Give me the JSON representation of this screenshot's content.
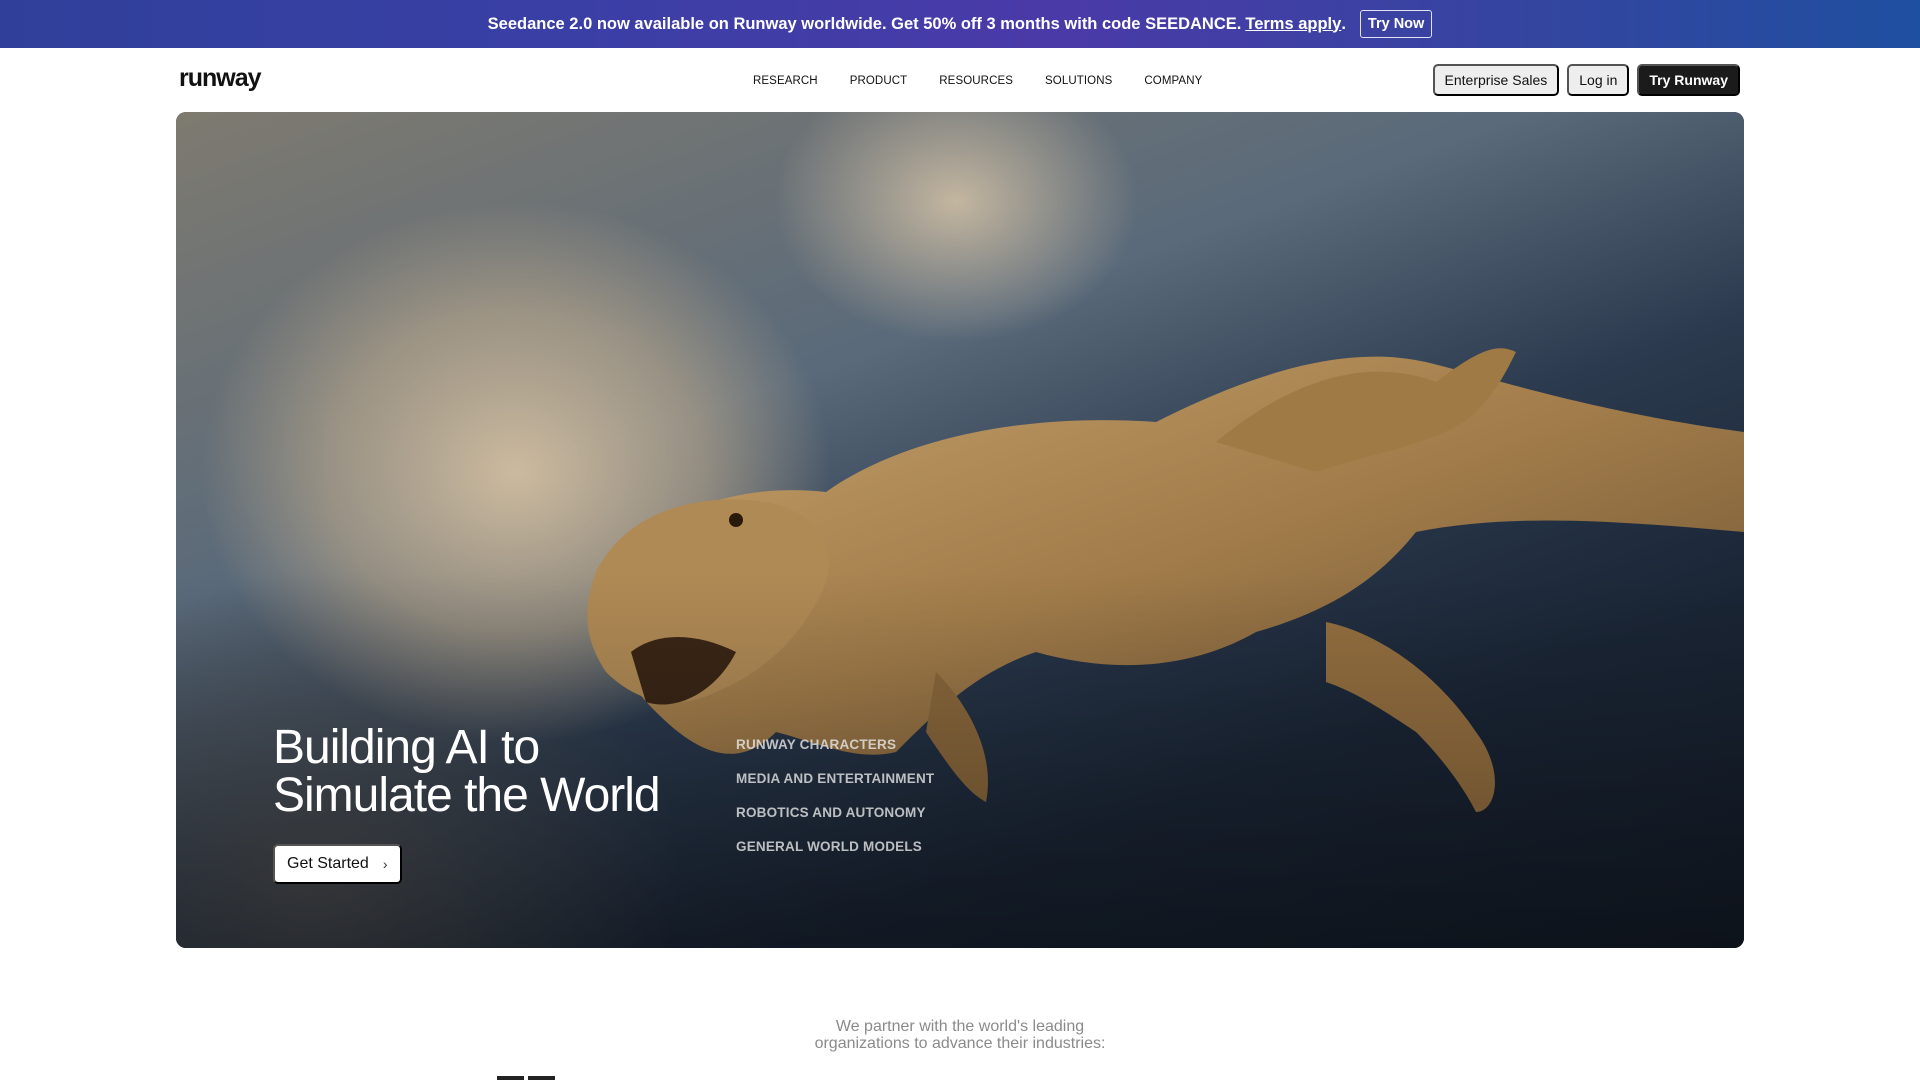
{
  "banner": {
    "message": "Seedance 2.0 now available on Runway worldwide. Get 50% off 3 months with code SEEDANCE.",
    "terms_link": "Terms apply",
    "terms_suffix": ".",
    "cta": "Try Now"
  },
  "header": {
    "logo": "runway",
    "nav": [
      {
        "label": "RESEARCH"
      },
      {
        "label": "PRODUCT"
      },
      {
        "label": "RESOURCES"
      },
      {
        "label": "SOLUTIONS"
      },
      {
        "label": "COMPANY"
      }
    ],
    "enterprise_label": "Enterprise Sales",
    "login_label": "Log in",
    "try_label": "Try Runway"
  },
  "hero": {
    "title_line1": "Building AI to",
    "title_line2": "Simulate the World",
    "cta": "Get Started",
    "links": [
      {
        "label": "RUNWAY CHARACTERS"
      },
      {
        "label": "MEDIA AND ENTERTAINMENT"
      },
      {
        "label": "ROBOTICS AND AUTONOMY"
      },
      {
        "label": "GENERAL WORLD MODELS"
      }
    ]
  },
  "partners": {
    "line1": "We partner with the world's leading",
    "line2": "organizations to advance their industries:"
  },
  "colors": {
    "banner_start": "#30409a",
    "banner_end": "#1f4fa0",
    "primary_button": "#1b1b1b",
    "secondary_button": "#eeeeee"
  }
}
